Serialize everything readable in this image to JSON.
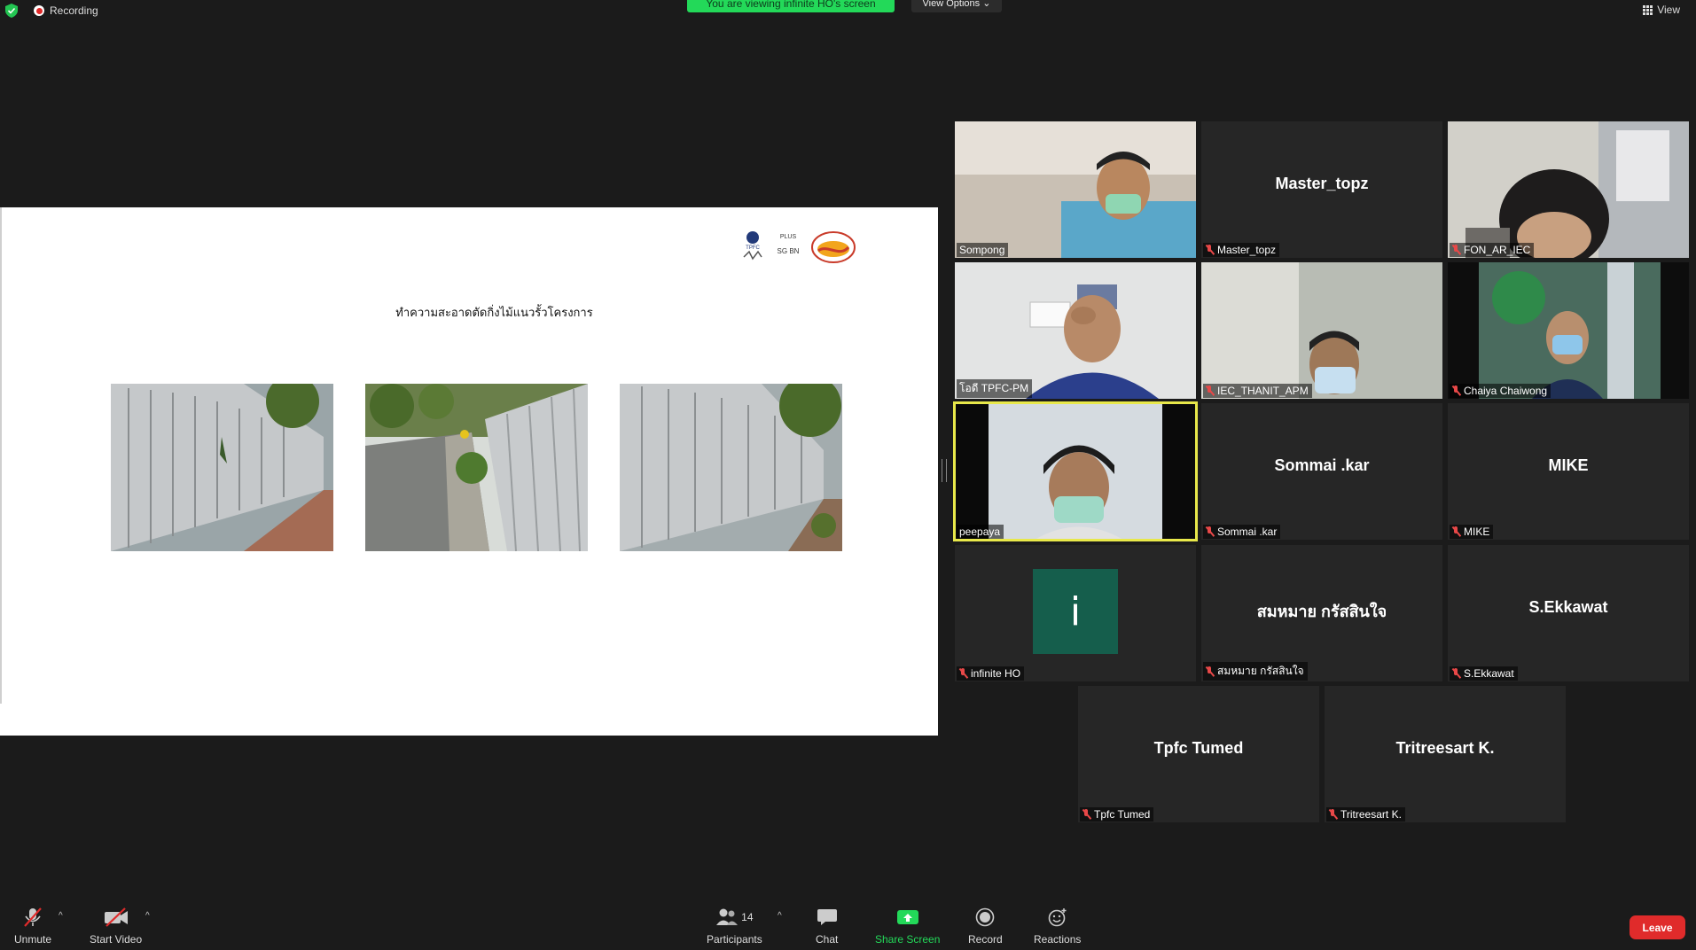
{
  "top": {
    "recording_label": "Recording",
    "viewing_banner": "You are viewing infinite HO's screen",
    "view_options_label": "View Options ⌄",
    "view_label": "View"
  },
  "slide": {
    "title": "ทำความสะอาดตัดกิ่งไม้แนวรั้วโครงการ",
    "logo_texts": [
      "TPFC",
      "PLUS",
      "SG BN"
    ]
  },
  "participants": [
    {
      "name": "Sompong",
      "muted": false,
      "video": true,
      "big_label": ""
    },
    {
      "name": "Master_topz",
      "muted": true,
      "video": false,
      "big_label": "Master_topz"
    },
    {
      "name": "FON_AR_IEC",
      "muted": true,
      "video": true,
      "big_label": ""
    },
    {
      "name": "โอดี TPFC-PM",
      "muted": false,
      "video": true,
      "big_label": ""
    },
    {
      "name": "IEC_THANIT_APM",
      "muted": true,
      "video": true,
      "big_label": ""
    },
    {
      "name": "Chaiya Chaiwong",
      "muted": true,
      "video": true,
      "big_label": ""
    },
    {
      "name": "peepaya",
      "muted": false,
      "video": true,
      "big_label": ""
    },
    {
      "name": "Sommai .kar",
      "muted": true,
      "video": false,
      "big_label": "Sommai .kar"
    },
    {
      "name": "MIKE",
      "muted": true,
      "video": false,
      "big_label": "MIKE"
    },
    {
      "name": "infinite HO",
      "muted": true,
      "video": false,
      "big_label": "",
      "avatar_letter": "i"
    },
    {
      "name": "สมหมาย กรัสสินใจ",
      "muted": true,
      "video": false,
      "big_label": "สมหมาย กรัสสินใจ"
    },
    {
      "name": "S.Ekkawat",
      "muted": true,
      "video": false,
      "big_label": "S.Ekkawat"
    },
    {
      "name": "Tpfc Tumed",
      "muted": true,
      "video": false,
      "big_label": "Tpfc Tumed"
    },
    {
      "name": "Tritreesart K.",
      "muted": true,
      "video": false,
      "big_label": "Tritreesart K."
    }
  ],
  "toolbar": {
    "unmute": "Unmute",
    "start_video": "Start Video",
    "participants": "Participants",
    "participant_count": "14",
    "chat": "Chat",
    "share_screen": "Share Screen",
    "record": "Record",
    "reactions": "Reactions",
    "leave": "Leave"
  },
  "colors": {
    "share_green": "#23d959",
    "leave_red": "#e02b2b",
    "active_speaker": "#e8e84a",
    "avatar_bg": "#155e4c"
  }
}
